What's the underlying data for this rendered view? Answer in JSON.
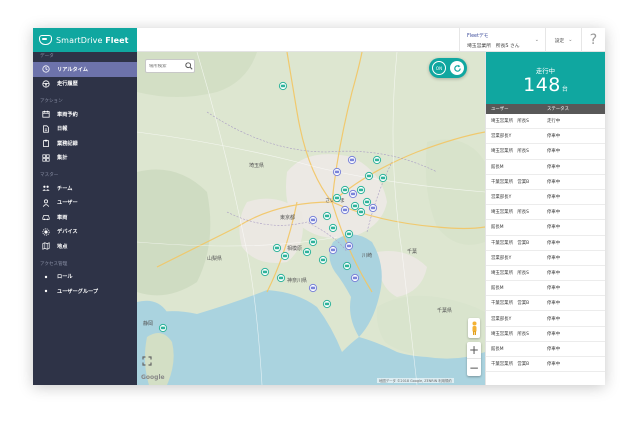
{
  "brand": {
    "name": "SmartDrive",
    "product": "Fleet"
  },
  "sidebar": {
    "sections": [
      {
        "title": "データ",
        "items": [
          {
            "label": "リアルタイム",
            "icon": "realtime-icon",
            "active": true
          },
          {
            "label": "走行履歴",
            "icon": "steering-wheel-icon",
            "active": false
          }
        ]
      },
      {
        "title": "アクション",
        "items": [
          {
            "label": "車両予約",
            "icon": "calendar-icon"
          },
          {
            "label": "日報",
            "icon": "document-icon"
          },
          {
            "label": "業務記録",
            "icon": "clipboard-icon"
          },
          {
            "label": "集計",
            "icon": "grid-icon"
          }
        ]
      },
      {
        "title": "マスター",
        "items": [
          {
            "label": "チーム",
            "icon": "team-icon"
          },
          {
            "label": "ユーザー",
            "icon": "user-icon"
          },
          {
            "label": "車両",
            "icon": "car-icon"
          },
          {
            "label": "デバイス",
            "icon": "device-icon"
          },
          {
            "label": "地点",
            "icon": "map-icon"
          }
        ]
      },
      {
        "title": "アクセス管理",
        "items": [
          {
            "label": "ロール",
            "icon": "bullet-icon"
          },
          {
            "label": "ユーザーグループ",
            "icon": "bullet-icon"
          }
        ]
      }
    ]
  },
  "header": {
    "fleet_line1": "Fleetデモ",
    "fleet_line2": "埼玉営業所　所長S さん",
    "settings_label": "設定",
    "help_label": "?"
  },
  "map": {
    "search_placeholder": "場所検索",
    "toggle_label": "ON",
    "google_label": "Google",
    "attribution": "地図データ ©2018 Google, ZENRIN  利用規約",
    "cities": [
      "埼玉県",
      "さいたま",
      "東京都",
      "山梨県",
      "相模原",
      "神奈川県",
      "川崎",
      "千葉",
      "千葉県",
      "静岡"
    ]
  },
  "panel": {
    "title": "走行中",
    "count": "148",
    "count_unit": "台",
    "col_user": "ユーザー",
    "col_status": "ステータス",
    "rows": [
      {
        "user": "埼玉営業所　所長S",
        "status": "走行中"
      },
      {
        "user": "営業部長Y",
        "status": "停車中"
      },
      {
        "user": "埼玉営業所　所長S",
        "status": "停車中"
      },
      {
        "user": "館長M",
        "status": "停車中"
      },
      {
        "user": "千葉営業所　営業B",
        "status": "停車中"
      },
      {
        "user": "営業部長Y",
        "status": "停車中"
      },
      {
        "user": "埼玉営業所　所長S",
        "status": "停車中"
      },
      {
        "user": "館長M",
        "status": "停車中"
      },
      {
        "user": "千葉営業所　営業B",
        "status": "停車中"
      },
      {
        "user": "営業部長Y",
        "status": "停車中"
      },
      {
        "user": "埼玉営業所　所長S",
        "status": "停車中"
      },
      {
        "user": "館長M",
        "status": "停車中"
      },
      {
        "user": "千葉営業所　営業B",
        "status": "停車中"
      },
      {
        "user": "営業部長Y",
        "status": "停車中"
      },
      {
        "user": "埼玉営業所　所長S",
        "status": "停車中"
      },
      {
        "user": "館長M",
        "status": "停車中"
      },
      {
        "user": "千葉営業所　営業B",
        "status": "停車中"
      }
    ]
  },
  "colors": {
    "brand_teal": "#10a7a0",
    "sidebar_bg": "#2e3347",
    "sidebar_active": "#6d73ab",
    "vehicle_moving": "#2fb39b",
    "vehicle_stopped": "#7a84d9"
  }
}
